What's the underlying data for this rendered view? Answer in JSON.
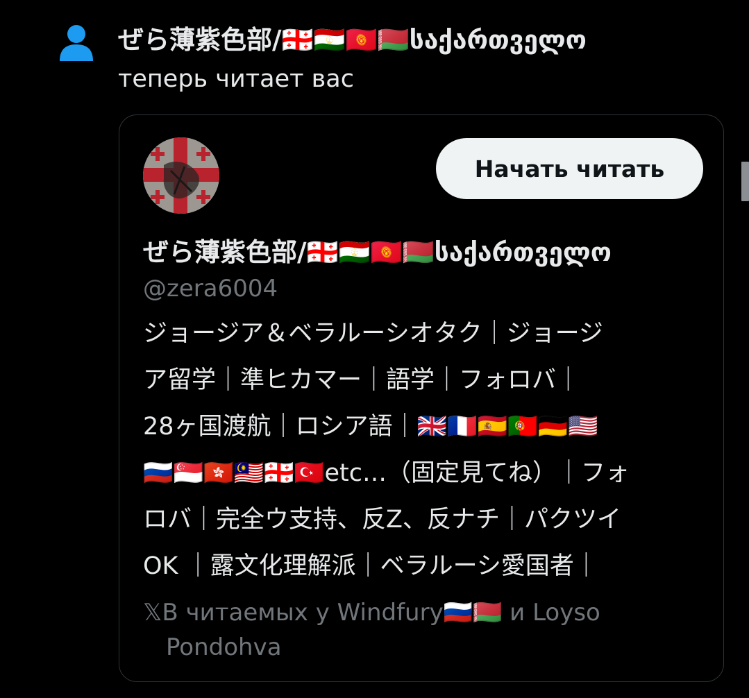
{
  "notification": {
    "icon": "person-icon",
    "accent_color": "#1d9bf0",
    "display_name": "ぜら薄紫色部/🇬🇪🇹🇯🇰🇬🇧🇾საქართველო",
    "action_text": "теперь читает вас"
  },
  "profile_card": {
    "display_name": "ぜら薄紫色部/🇬🇪🇹🇯🇰🇬🇧🇾საქართველო",
    "handle": "@zera6004",
    "follow_button_label": "Начать читать",
    "bio_lines": [
      "ジョージア＆ベラルーシオタク｜ジョージ",
      "ア留学｜準ヒカマー｜語学｜フォロバ｜",
      "28ヶ国渡航｜ロシア語｜🇬🇧🇫🇷🇪🇸🇵🇹🇩🇪🇺🇸",
      "🇷🇺🇸🇬🇭🇰🇲🇾🇬🇪🇹🇷etc…（固定見てね）｜フォ",
      "ロバ｜完全ウ支持、反Z、反ナチ｜パクツイ",
      "OK ｜露文化理解派｜ベラルーシ愛国者｜"
    ],
    "followed_by_line1": "𝕏В читаемых у Windfury🇷🇺🇧🇾 и Loyso",
    "followed_by_line2": "Pondohva"
  },
  "colors": {
    "background": "#000000",
    "primary_text": "#e7e9ea",
    "secondary_text": "#71767b",
    "card_border": "#2f3336",
    "button_bg": "#eff3f4",
    "button_text": "#0f1419"
  }
}
